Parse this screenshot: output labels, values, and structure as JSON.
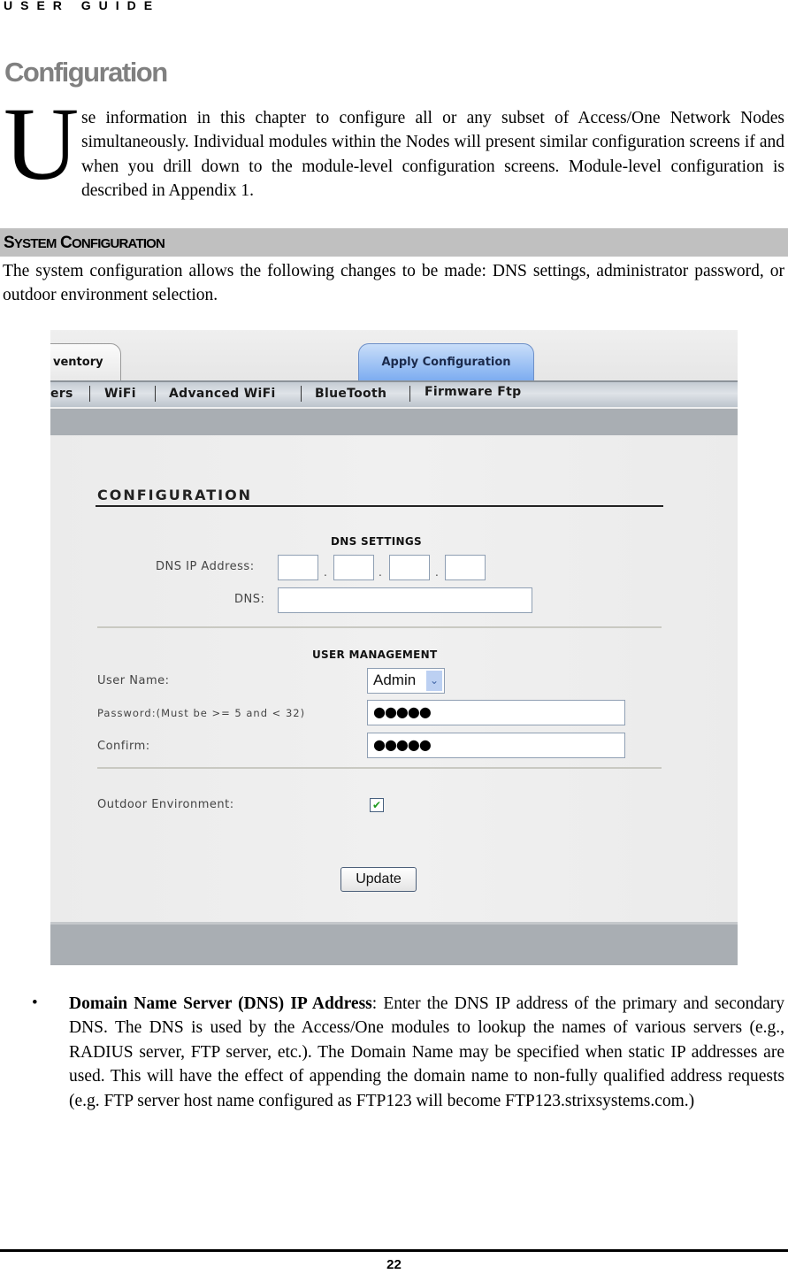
{
  "header": {
    "label": "USER GUIDE"
  },
  "chapter": {
    "title": "Configuration",
    "dropcap": "U",
    "intro": "se information in this chapter to configure all or any subset of Access/One Network Nodes simultaneously. Individual modules within the Nodes will present similar configuration screens if and when you drill down to the module-level configuration screens. Module-level configuration is described in Appendix 1."
  },
  "section": {
    "title_first_cap": "S",
    "title_first_rest": "YSTEM",
    "title_second_cap": "C",
    "title_second_rest": "ONFIGURATION",
    "body": "The system configuration allows the following changes to be made: DNS settings, administrator password, or outdoor environment selection."
  },
  "screenshot": {
    "tabs": [
      {
        "label": "ventory",
        "active": false
      },
      {
        "label": "Apply Configuration",
        "active": true
      }
    ],
    "nav_items": [
      "ers",
      "WiFi",
      "Advanced WiFi",
      "BlueTooth",
      "Firmware Ftp"
    ],
    "form_title": "CONFIGURATION",
    "dns_section": {
      "heading": "DNS SETTINGS",
      "ip_label": "DNS IP Address:",
      "ip_octets": [
        "",
        "",
        "",
        ""
      ],
      "ip_separator": ".",
      "dns_label": "DNS:",
      "dns_value": ""
    },
    "user_section": {
      "heading": "USER MANAGEMENT",
      "username_label": "User Name:",
      "username_value": "Admin",
      "password_label": "Password:(Must be >= 5 and < 32)",
      "password_value": "●●●●●",
      "confirm_label": "Confirm:",
      "confirm_value": "●●●●●"
    },
    "outdoor": {
      "label": "Outdoor Environment:",
      "checked": true,
      "check_glyph": "✔"
    },
    "update_label": "Update",
    "select_arrow": "⌄"
  },
  "bullets": [
    {
      "glyph": "•",
      "term": "Domain Name Server (DNS) IP Address",
      "text": ": Enter the DNS IP address of the primary and secondary DNS. The DNS is used by the Access/One modules to lookup the names of various servers (e.g., RADIUS server, FTP server, etc.). The Domain Name may be specified when static IP addresses are used. This will have the effect of appending the domain name to non-fully qualified address requests (e.g. FTP server host name configured as FTP123 will become FTP123.strixsystems.com.)"
    }
  ],
  "footer": {
    "page_number": "22"
  }
}
